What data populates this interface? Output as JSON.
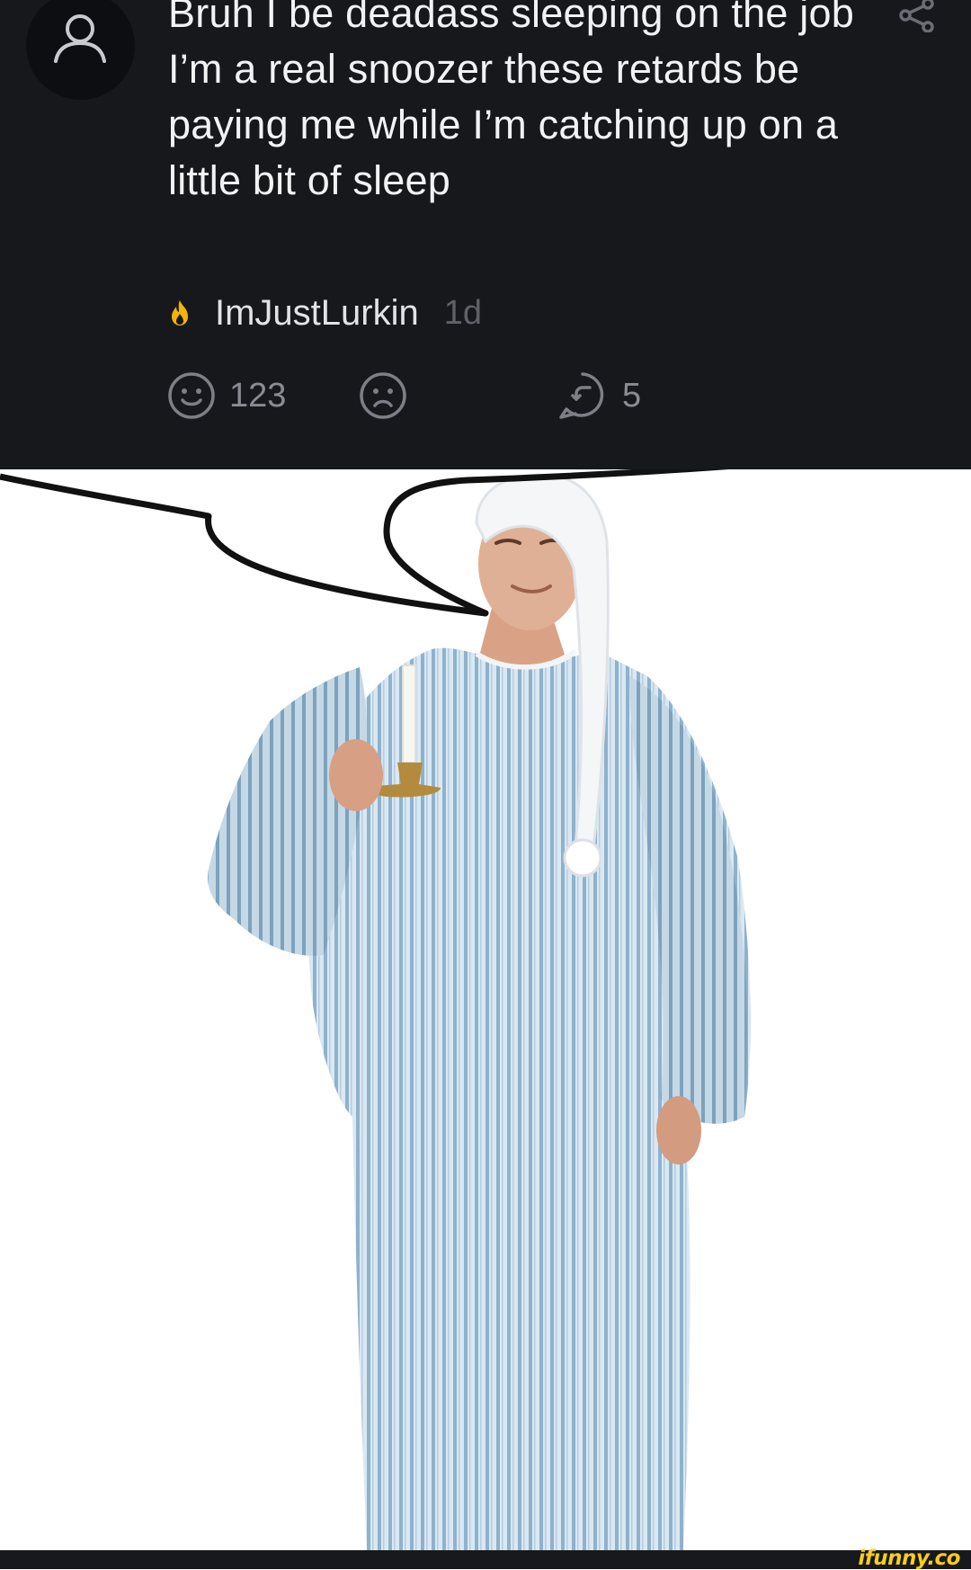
{
  "comment": {
    "text": "Bruh I be deadass sleeping on the job I’m a real snoozer these retards be paying me while I’m catching up on a little bit of sleep",
    "author": "ImJustLurkin",
    "time_ago": "1d",
    "smile_count": "123",
    "reply_count": "5",
    "icons": {
      "avatar": "user-avatar-icon",
      "share": "share-icon",
      "author_badge": "flame-icon",
      "smile": "smile-icon",
      "frown": "frown-icon",
      "reply": "reply-icon"
    }
  },
  "watermark": "ifunny.co",
  "colors": {
    "card_background": "#17181c",
    "text": "#f2f2f4",
    "muted": "#5f6168",
    "accent_flame": "#f5b400",
    "watermark": "#f8cd1c"
  }
}
